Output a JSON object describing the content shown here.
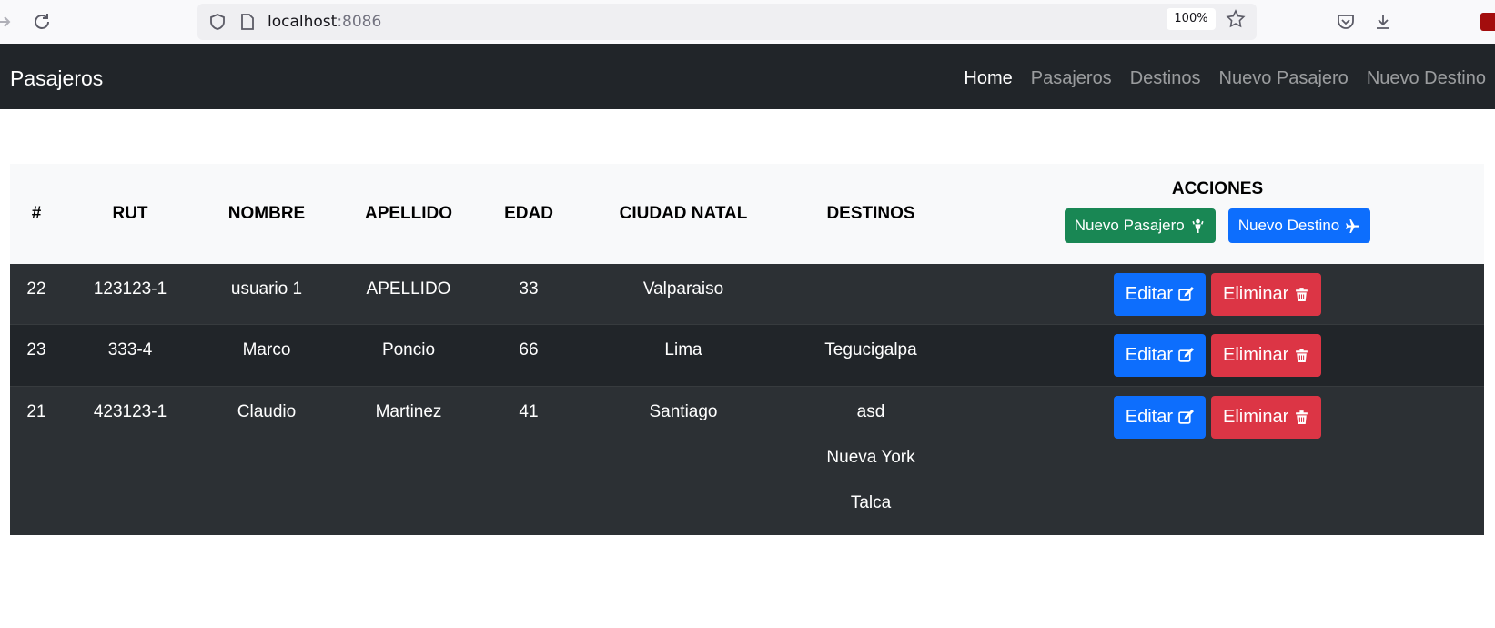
{
  "browser": {
    "url_host": "localhost",
    "url_port": ":8086",
    "zoom": "100%"
  },
  "navbar": {
    "brand": "Pasajeros",
    "links": [
      {
        "label": "Home",
        "active": true
      },
      {
        "label": "Pasajeros",
        "active": false
      },
      {
        "label": "Destinos",
        "active": false
      },
      {
        "label": "Nuevo Pasajero",
        "active": false
      },
      {
        "label": "Nuevo Destino",
        "active": false
      }
    ]
  },
  "table": {
    "headers": {
      "num": "#",
      "rut": "RUT",
      "nombre": "NOMBRE",
      "apellido": "APELLIDO",
      "edad": "EDAD",
      "ciudad": "CIUDAD NATAL",
      "destinos": "DESTINOS",
      "acciones": "ACCIONES"
    },
    "header_buttons": {
      "nuevo_pasajero": "Nuevo Pasajero",
      "nuevo_destino": "Nuevo Destino"
    },
    "row_buttons": {
      "editar": "Editar",
      "eliminar": "Eliminar"
    },
    "rows": [
      {
        "id": "22",
        "rut": "123123-1",
        "nombre": "usuario 1",
        "apellido": "APELLIDO",
        "edad": "33",
        "ciudad": "Valparaiso",
        "destinos": []
      },
      {
        "id": "23",
        "rut": "333-4",
        "nombre": "Marco",
        "apellido": "Poncio",
        "edad": "66",
        "ciudad": "Lima",
        "destinos": [
          "Tegucigalpa"
        ]
      },
      {
        "id": "21",
        "rut": "423123-1",
        "nombre": "Claudio",
        "apellido": "Martinez",
        "edad": "41",
        "ciudad": "Santiago",
        "destinos": [
          "asd",
          "Nueva York",
          "Talca"
        ]
      }
    ]
  },
  "colors": {
    "navbar_bg": "#212529",
    "btn_primary": "#0d6efd",
    "btn_success": "#198754",
    "btn_danger": "#dc3545"
  }
}
